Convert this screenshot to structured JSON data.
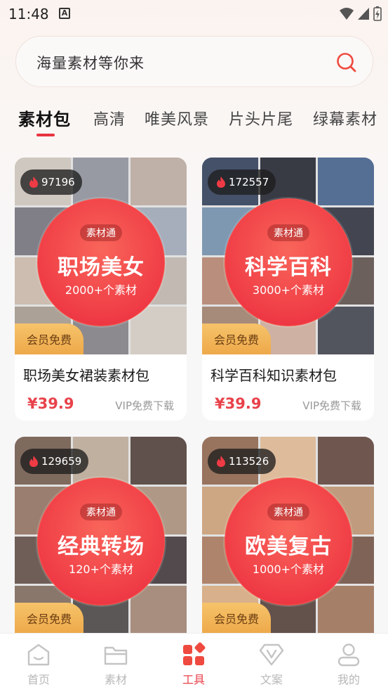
{
  "status_bar": {
    "time": "11:48"
  },
  "search": {
    "placeholder": "海量素材等你来"
  },
  "tabs": [
    {
      "label": "素材包",
      "active": true
    },
    {
      "label": "高清"
    },
    {
      "label": "唯美风景"
    },
    {
      "label": "片头片尾"
    },
    {
      "label": "绿幕素材"
    }
  ],
  "cards": [
    {
      "hot": "97196",
      "tag": "素材通",
      "title": "职场美女",
      "count": "2000+个素材",
      "badge": "会员免费",
      "name": "职场美女裙装素材包",
      "price": "¥39.9",
      "vip": "VIP免费下载"
    },
    {
      "hot": "172557",
      "tag": "素材通",
      "title": "科学百科",
      "count": "3000+个素材",
      "badge": "会员免费",
      "name": "科学百科知识素材包",
      "price": "¥39.9",
      "vip": "VIP免费下载"
    },
    {
      "hot": "129659",
      "tag": "素材通",
      "title": "经典转场",
      "count": "120+个素材",
      "badge": "会员免费",
      "name": "",
      "price": "",
      "vip": ""
    },
    {
      "hot": "113526",
      "tag": "素材通",
      "title": "欧美复古",
      "count": "1000+个素材",
      "badge": "会员免费",
      "name": "",
      "price": "",
      "vip": ""
    }
  ],
  "nav": [
    {
      "label": "首页",
      "icon": "home-icon"
    },
    {
      "label": "素材",
      "icon": "folder-icon"
    },
    {
      "label": "工具",
      "icon": "tools-icon",
      "active": true
    },
    {
      "label": "文案",
      "icon": "copywriting-icon"
    },
    {
      "label": "我的",
      "icon": "profile-icon"
    }
  ],
  "colors": {
    "accent": "#e8424a",
    "member": "#f0b050"
  }
}
